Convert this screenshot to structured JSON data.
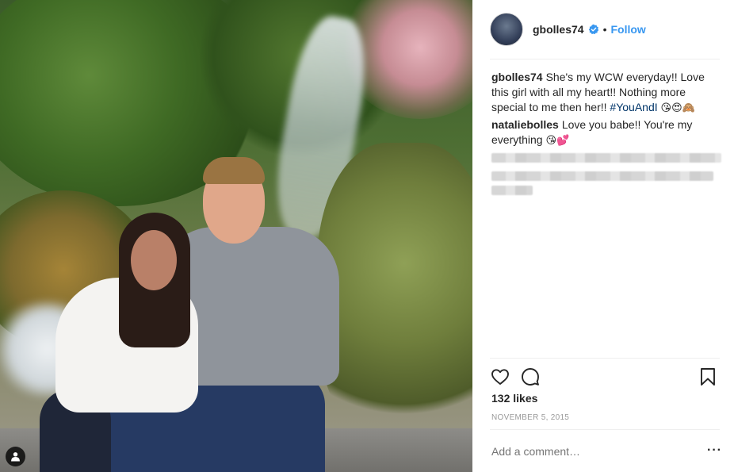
{
  "post": {
    "username": "gbolles74",
    "verified": true,
    "follow_label": "Follow",
    "separator": "•"
  },
  "comments": [
    {
      "user": "gbolles74",
      "text_before": "She's my WCW everyday!! Love this girl with all my heart!! Nothing more special to me then her!! ",
      "hashtag": "#YouAndI",
      "emojis": "😘😍🙈"
    },
    {
      "user": "nataliebolles",
      "text_before": "Love you babe!! You're my everything ",
      "emojis": "😘💕"
    }
  ],
  "stats": {
    "likes": "132 likes",
    "date": "NOVEMBER 5, 2015"
  },
  "comment_input": {
    "placeholder": "Add a comment…"
  },
  "icons": {
    "like": "heart-icon",
    "comment": "comment-bubble-icon",
    "save": "bookmark-icon",
    "more": "more-options-icon",
    "user_tag": "user-tag-icon",
    "verified": "verified-badge-icon"
  },
  "colors": {
    "link": "#3897f0",
    "hashtag": "#003569",
    "text": "#262626",
    "muted": "#999999"
  }
}
